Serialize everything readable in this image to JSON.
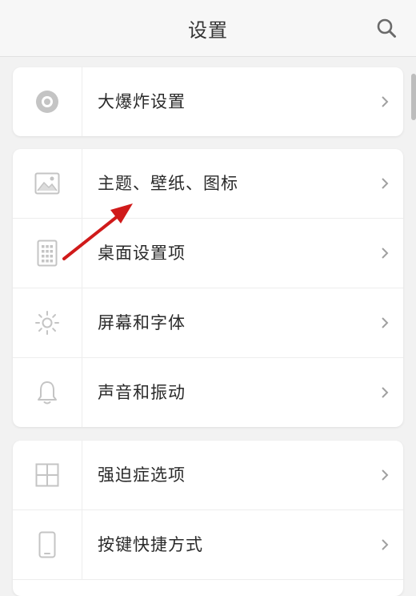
{
  "header": {
    "title": "设置",
    "search_icon": "search-icon"
  },
  "groups": [
    {
      "items": [
        {
          "label": "大爆炸设置",
          "icon": "big-bang-icon"
        }
      ]
    },
    {
      "items": [
        {
          "label": "主题、壁纸、图标",
          "icon": "image-icon"
        },
        {
          "label": "桌面设置项",
          "icon": "keypad-icon"
        },
        {
          "label": "屏幕和字体",
          "icon": "brightness-icon"
        },
        {
          "label": "声音和振动",
          "icon": "bell-icon"
        }
      ]
    },
    {
      "items": [
        {
          "label": "强迫症选项",
          "icon": "grid-icon"
        },
        {
          "label": "按键快捷方式",
          "icon": "phone-icon"
        }
      ]
    }
  ],
  "colors": {
    "annotation_arrow": "#d01a1a",
    "icon_gray": "#c4c4c4",
    "chevron_gray": "#a0a0a0"
  }
}
